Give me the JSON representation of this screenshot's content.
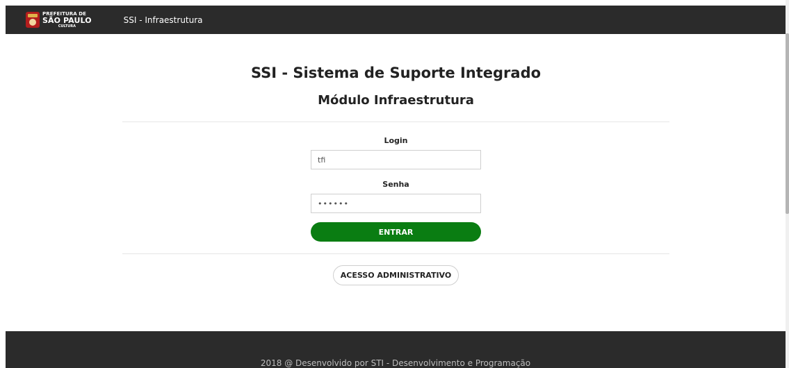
{
  "navbar": {
    "logo": {
      "line1": "PREFEITURA DE",
      "line2": "SÃO PAULO",
      "line3": "CULTURA"
    },
    "brand": "SSI - Infraestrutura"
  },
  "main": {
    "title": "SSI - Sistema de Suporte Integrado",
    "subtitle": "Módulo Infraestrutura",
    "form": {
      "login_label": "Login",
      "login_value": "tfi",
      "senha_label": "Senha",
      "senha_value": "••••••",
      "submit_label": "ENTRAR"
    },
    "admin_button_label": "ACESSO ADMINISTRATIVO"
  },
  "footer": {
    "text": "2018 @ Desenvolvido por STI - Desenvolvimento e Programação"
  },
  "colors": {
    "navbar_bg": "#2b2b2b",
    "primary_button": "#0a7d12",
    "footer_bg": "#2b2b2b"
  },
  "icons": {
    "logo": "prefeitura-sao-paulo-seal-icon"
  }
}
